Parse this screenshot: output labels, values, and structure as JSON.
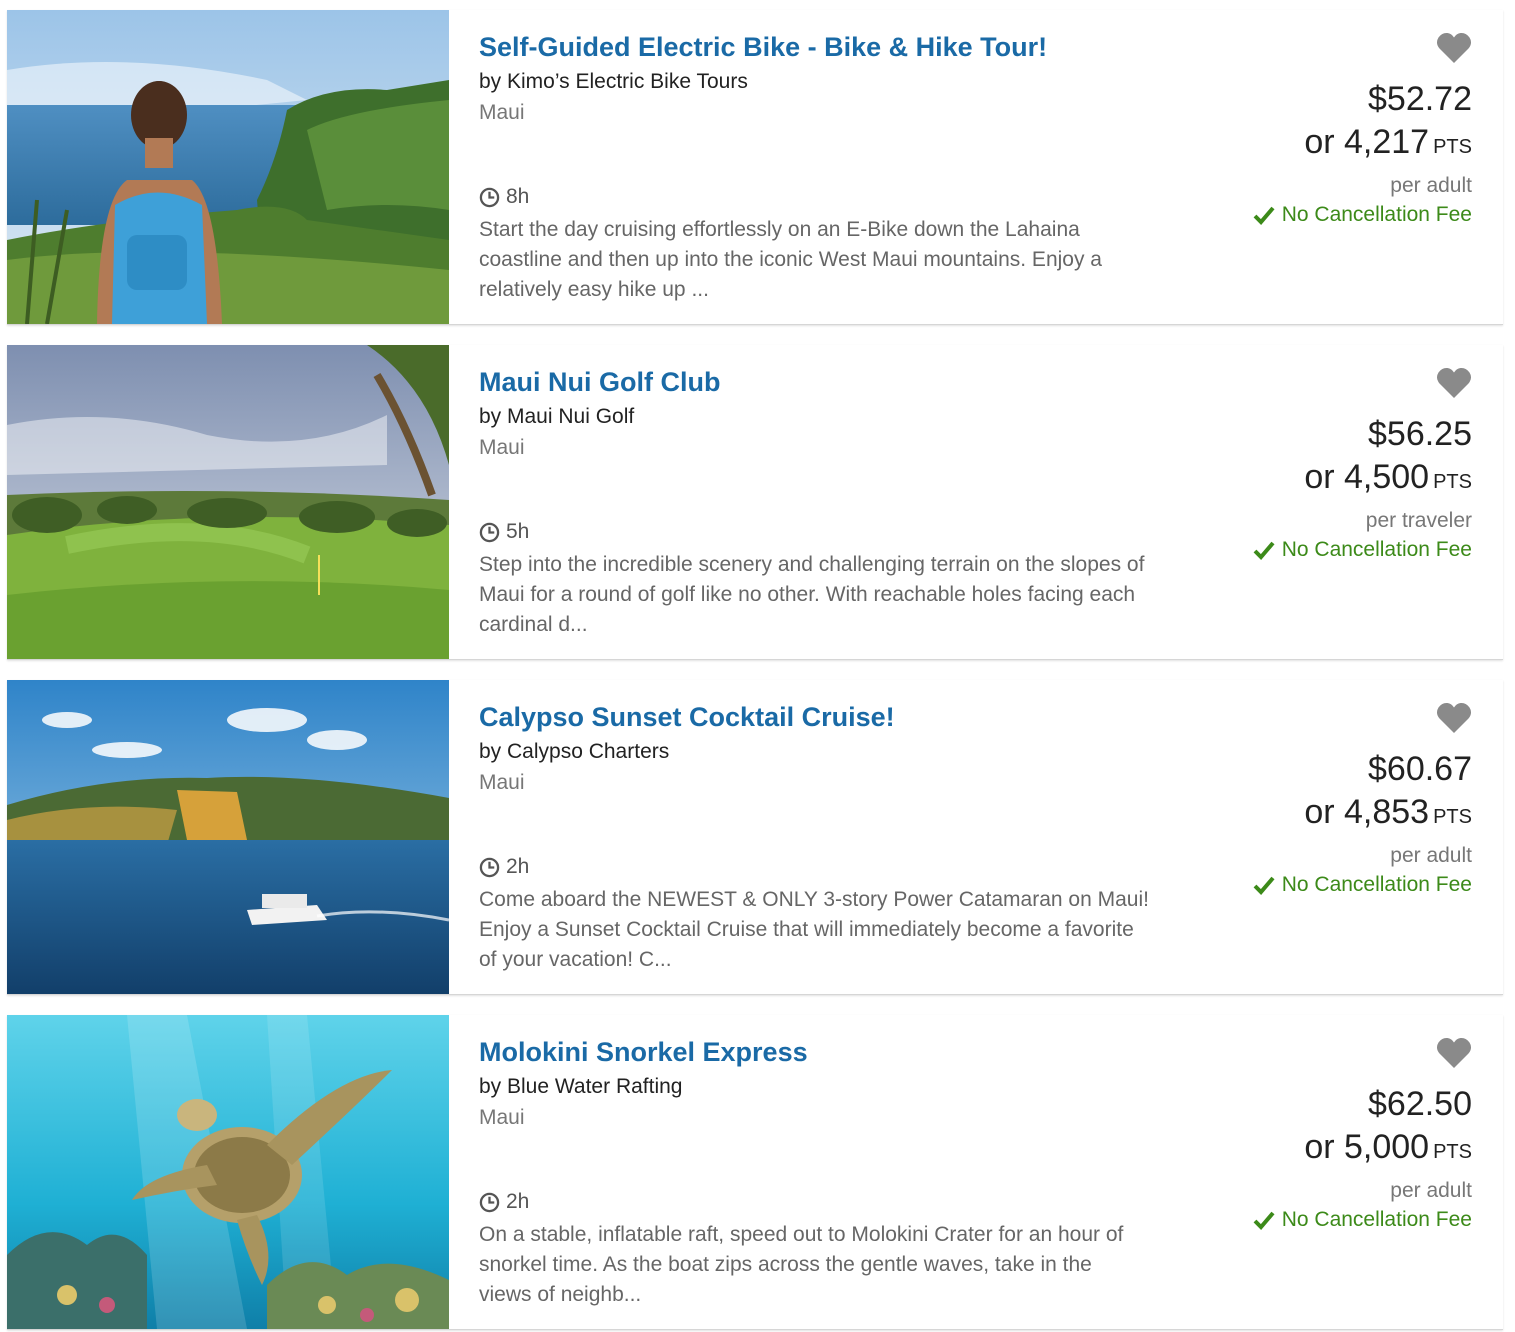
{
  "listings": [
    {
      "title": "Self-Guided Electric Bike - Bike & Hike Tour!",
      "vendor": "by Kimo’s Electric Bike Tours",
      "location": "Maui",
      "duration": "8h",
      "description": "Start the day cruising effortlessly on an E-Bike down the Lahaina coastline and then up into the iconic West Maui mountains. Enjoy a relatively easy hike up ...",
      "price": "$52.72",
      "points_prefix": "or 4,217",
      "points_label": "PTS",
      "per": "per adult",
      "cancellation": "No Cancellation Fee"
    },
    {
      "title": "Maui Nui Golf Club",
      "vendor": "by Maui Nui Golf",
      "location": "Maui",
      "duration": "5h",
      "description": "Step into the incredible scenery and challenging terrain on the slopes of Maui for a round of golf like no other. With reachable holes facing each cardinal d...",
      "price": "$56.25",
      "points_prefix": "or 4,500",
      "points_label": "PTS",
      "per": "per traveler",
      "cancellation": "No Cancellation Fee"
    },
    {
      "title": "Calypso Sunset Cocktail Cruise!",
      "vendor": "by Calypso Charters",
      "location": "Maui",
      "duration": "2h",
      "description": "Come aboard the NEWEST & ONLY 3-story Power Catamaran on Maui! Enjoy a Sunset Cocktail Cruise that will immediately become a favorite of your vacation! C...",
      "price": "$60.67",
      "points_prefix": "or 4,853",
      "points_label": "PTS",
      "per": "per adult",
      "cancellation": "No Cancellation Fee"
    },
    {
      "title": "Molokini Snorkel Express",
      "vendor": "by Blue Water Rafting",
      "location": "Maui",
      "duration": "2h",
      "description": "On a stable, inflatable raft, speed out to Molokini Crater for an hour of snorkel time. As the boat zips across the gentle waves, take in the views of neighb...",
      "price": "$62.50",
      "points_prefix": "or 5,000",
      "points_label": "PTS",
      "per": "per adult",
      "cancellation": "No Cancellation Fee"
    }
  ],
  "colors": {
    "title": "#1a6aa6",
    "price": "#222222",
    "cancellation": "#3c8a19",
    "heart": "#8a8a8a"
  },
  "icons": {
    "favorite": "heart-icon",
    "duration": "clock-icon",
    "cancellation": "check-icon"
  }
}
